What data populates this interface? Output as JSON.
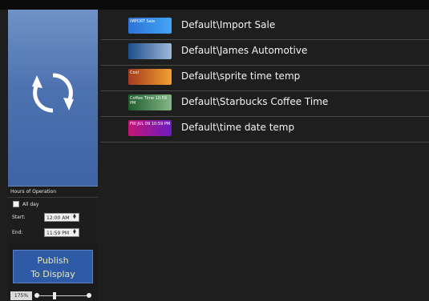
{
  "playlist": [
    {
      "label": "Default\\Import Sale",
      "thumb": "IMPORT Sale"
    },
    {
      "label": "Default\\James Automotive",
      "thumb": ""
    },
    {
      "label": "Default\\sprite time temp",
      "thumb": "Cool"
    },
    {
      "label": "Default\\Starbucks Coffee Time",
      "thumb": "Coffee Time 10:59 PM"
    },
    {
      "label": "Default\\time date temp",
      "thumb": "FRI JUL 09 10:59 PM"
    }
  ],
  "hours": {
    "title": "Hours of Operation",
    "allday_label": "All day",
    "start_label": "Start:",
    "start_value": "12:00 AM",
    "end_label": "End:",
    "end_value": "11:59 PM"
  },
  "publish": {
    "line1": "Publish",
    "line2": "To Display"
  },
  "zoom": {
    "level": "175%"
  }
}
